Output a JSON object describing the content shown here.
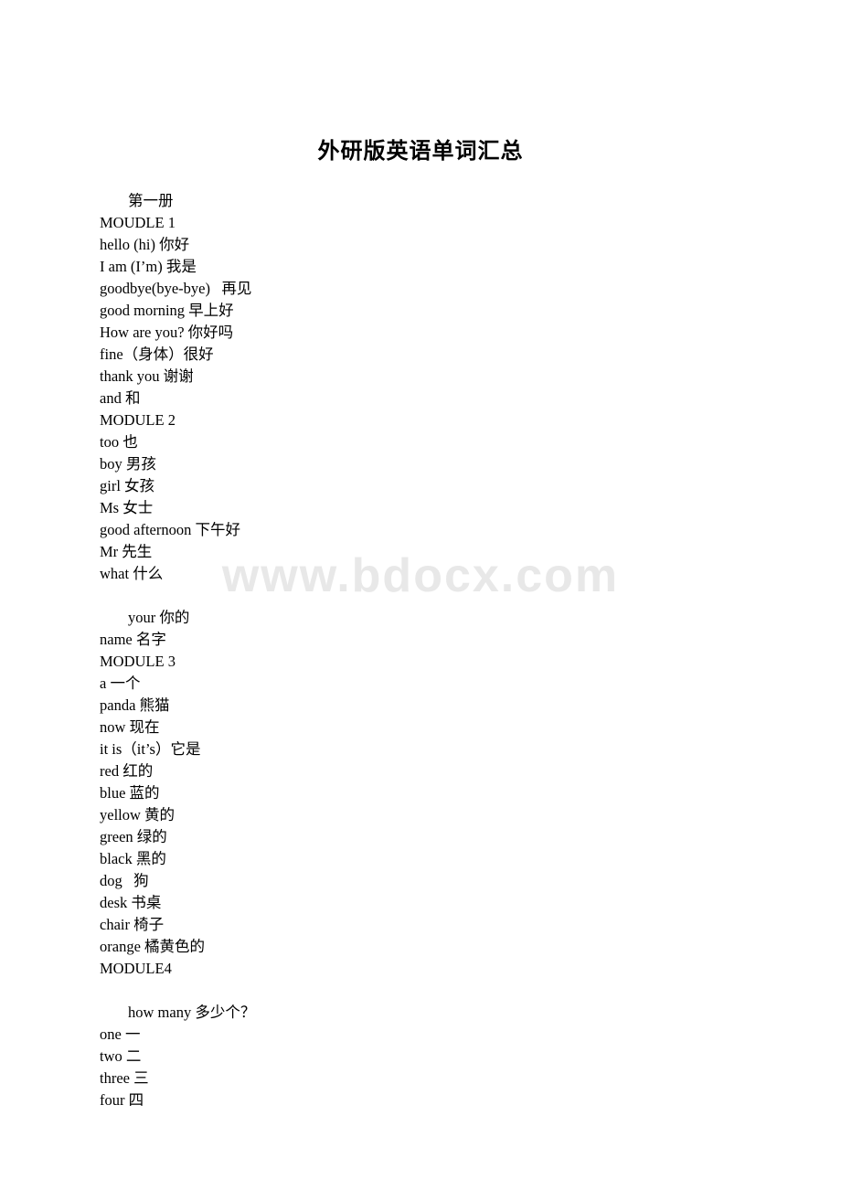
{
  "document": {
    "title": "外研版英语单词汇总",
    "watermark": "www.bdocx.com",
    "lines": [
      {
        "text": "第一册",
        "indent": true
      },
      {
        "text": "MOUDLE 1",
        "indent": false
      },
      {
        "text": "hello (hi) 你好",
        "indent": false
      },
      {
        "text": "I am (I’m) 我是",
        "indent": false
      },
      {
        "text": "goodbye(bye-bye)   再见",
        "indent": false
      },
      {
        "text": "good morning 早上好",
        "indent": false
      },
      {
        "text": "How are you? 你好吗",
        "indent": false
      },
      {
        "text": "fine（身体）很好",
        "indent": false
      },
      {
        "text": "thank you 谢谢",
        "indent": false
      },
      {
        "text": "and 和",
        "indent": false
      },
      {
        "text": "MODULE 2",
        "indent": false
      },
      {
        "text": "too 也",
        "indent": false
      },
      {
        "text": "boy 男孩",
        "indent": false
      },
      {
        "text": "girl 女孩",
        "indent": false
      },
      {
        "text": "Ms 女士",
        "indent": false
      },
      {
        "text": "good afternoon 下午好",
        "indent": false
      },
      {
        "text": "Mr 先生",
        "indent": false
      },
      {
        "text": "what 什么",
        "indent": false
      },
      {
        "text": "",
        "indent": false
      },
      {
        "text": "your 你的",
        "indent": true
      },
      {
        "text": "name 名字",
        "indent": false
      },
      {
        "text": "MODULE 3",
        "indent": false
      },
      {
        "text": "a 一个",
        "indent": false
      },
      {
        "text": "panda 熊猫",
        "indent": false
      },
      {
        "text": "now 现在",
        "indent": false
      },
      {
        "text": "it is（it’s）它是",
        "indent": false
      },
      {
        "text": "red 红的",
        "indent": false
      },
      {
        "text": "blue 蓝的",
        "indent": false
      },
      {
        "text": "yellow 黄的",
        "indent": false
      },
      {
        "text": "green 绿的",
        "indent": false
      },
      {
        "text": "black 黑的",
        "indent": false
      },
      {
        "text": "dog   狗",
        "indent": false
      },
      {
        "text": "desk 书桌",
        "indent": false
      },
      {
        "text": "chair 椅子",
        "indent": false
      },
      {
        "text": "orange 橘黄色的",
        "indent": false
      },
      {
        "text": "MODULE4",
        "indent": false
      },
      {
        "text": "",
        "indent": false
      },
      {
        "text": "how many 多少个？",
        "indent": true
      },
      {
        "text": "one 一",
        "indent": false
      },
      {
        "text": "two 二",
        "indent": false
      },
      {
        "text": "three 三",
        "indent": false
      },
      {
        "text": "four 四",
        "indent": false
      }
    ]
  }
}
